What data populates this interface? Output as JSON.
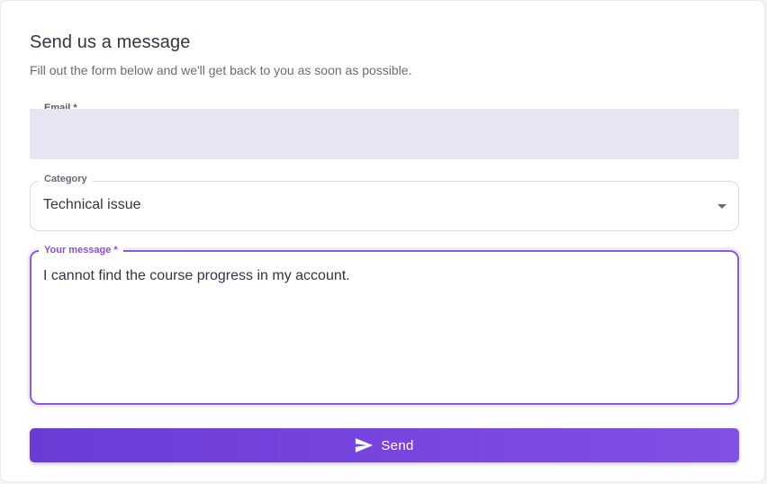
{
  "form": {
    "title": "Send us a message",
    "subtitle": "Fill out the form below and we'll get back to you as soon as possible.",
    "email": {
      "label": "Email *",
      "value": "",
      "placeholder": ""
    },
    "category": {
      "label": "Category",
      "selected": "Technical issue"
    },
    "message": {
      "label": "Your message *",
      "value": "I cannot find the course progress in my account."
    },
    "send_button": {
      "label": "Send",
      "icon": "send-icon"
    }
  },
  "colors": {
    "accent": "#7a47e0",
    "filled_field_bg": "#e8e4f2",
    "focused_border": "#8a5ae0",
    "text": "#34344a"
  }
}
